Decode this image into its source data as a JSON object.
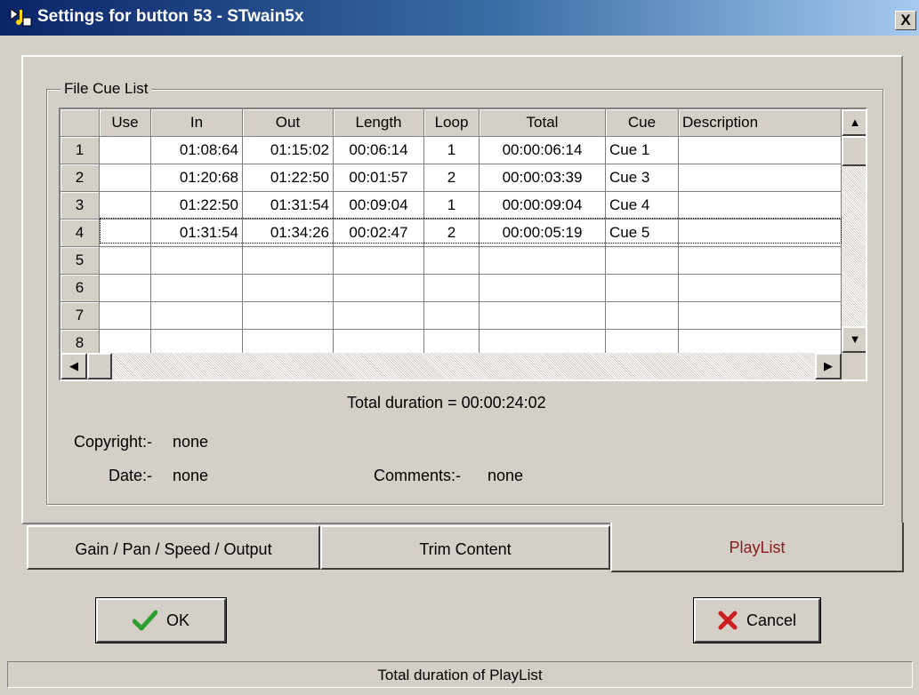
{
  "window": {
    "title": "Settings for button 53 - STwain5x",
    "close_label": "X"
  },
  "groupbox": {
    "label": "File Cue List"
  },
  "grid": {
    "columns": [
      "",
      "Use",
      "In",
      "Out",
      "Length",
      "Loop",
      "Total",
      "Cue",
      "Description"
    ],
    "rows": [
      {
        "num": "1",
        "use": "",
        "in": "01:08:64",
        "out": "01:15:02",
        "length": "00:06:14",
        "loop": "1",
        "total": "00:00:06:14",
        "cue": "Cue 1",
        "description": ""
      },
      {
        "num": "2",
        "use": "",
        "in": "01:20:68",
        "out": "01:22:50",
        "length": "00:01:57",
        "loop": "2",
        "total": "00:00:03:39",
        "cue": "Cue 3",
        "description": ""
      },
      {
        "num": "3",
        "use": "",
        "in": "01:22:50",
        "out": "01:31:54",
        "length": "00:09:04",
        "loop": "1",
        "total": "00:00:09:04",
        "cue": "Cue 4",
        "description": ""
      },
      {
        "num": "4",
        "use": "",
        "in": "01:31:54",
        "out": "01:34:26",
        "length": "00:02:47",
        "loop": "2",
        "total": "00:00:05:19",
        "cue": "Cue 5",
        "description": ""
      },
      {
        "num": "5",
        "use": "",
        "in": "",
        "out": "",
        "length": "",
        "loop": "",
        "total": "",
        "cue": "",
        "description": ""
      },
      {
        "num": "6",
        "use": "",
        "in": "",
        "out": "",
        "length": "",
        "loop": "",
        "total": "",
        "cue": "",
        "description": ""
      },
      {
        "num": "7",
        "use": "",
        "in": "",
        "out": "",
        "length": "",
        "loop": "",
        "total": "",
        "cue": "",
        "description": ""
      },
      {
        "num": "8",
        "use": "",
        "in": "",
        "out": "",
        "length": "",
        "loop": "",
        "total": "",
        "cue": "",
        "description": ""
      }
    ],
    "selected_row": "4"
  },
  "info": {
    "total_duration": "Total duration = 00:00:24:02",
    "copyright_label": "Copyright:-",
    "copyright_value": "none",
    "date_label": "Date:-",
    "date_value": "none",
    "comments_label": "Comments:-",
    "comments_value": "none"
  },
  "tabs": [
    {
      "label": "Gain / Pan / Speed / Output",
      "active": false
    },
    {
      "label": "Trim Content",
      "active": false
    },
    {
      "label": "PlayList",
      "active": true
    }
  ],
  "buttons": {
    "ok_label": "OK",
    "cancel_label": "Cancel"
  },
  "status_bar": {
    "text": "Total duration of PlayList"
  },
  "colors": {
    "active_tab_text": "#8b1a1a",
    "ok_check": "#2e9e2e",
    "cancel_x": "#cc1f1f",
    "titlebar": "#0a246a"
  },
  "icons": [
    "app-icon",
    "close-icon",
    "scroll-up-icon",
    "scroll-down-icon",
    "scroll-left-icon",
    "scroll-right-icon",
    "checkmark-icon",
    "x-mark-icon"
  ]
}
